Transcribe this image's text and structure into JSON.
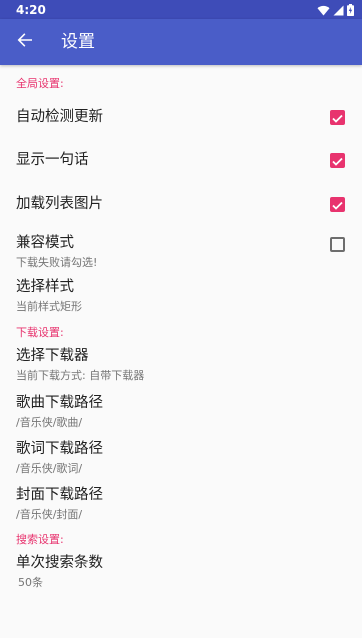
{
  "status_bar": {
    "time": "4:20",
    "icons": [
      "wifi-icon",
      "signal-icon",
      "battery-icon"
    ]
  },
  "app_bar": {
    "back_icon": "arrow-left-icon",
    "title": "设置"
  },
  "colors": {
    "primary": "#4a5dc8",
    "primary_dark": "#3e4cb8",
    "accent": "#e8336e"
  },
  "sections": {
    "global": {
      "header": "全局设置:",
      "auto_update": {
        "title": "自动检测更新",
        "checked": true
      },
      "show_quote": {
        "title": "显示一句话",
        "checked": true
      },
      "load_list_images": {
        "title": "加载列表图片",
        "checked": true
      },
      "compat_mode": {
        "title": "兼容模式",
        "summary": "下载失败请勾选!",
        "checked": false
      },
      "select_style": {
        "title": "选择样式",
        "summary": "当前样式矩形"
      }
    },
    "download": {
      "header": "下载设置:",
      "select_downloader": {
        "title": "选择下载器",
        "summary": "当前下载方式: 自带下载器"
      },
      "song_path": {
        "title": "歌曲下载路径",
        "summary": "/音乐侠/歌曲/"
      },
      "lyrics_path": {
        "title": "歌词下载路径",
        "summary": "/音乐侠/歌词/"
      },
      "cover_path": {
        "title": "封面下载路径",
        "summary": "/音乐侠/封面/"
      }
    },
    "search": {
      "header": "搜索设置:",
      "results_per_search": {
        "title": "单次搜索条数",
        "summary": "50条"
      }
    }
  }
}
